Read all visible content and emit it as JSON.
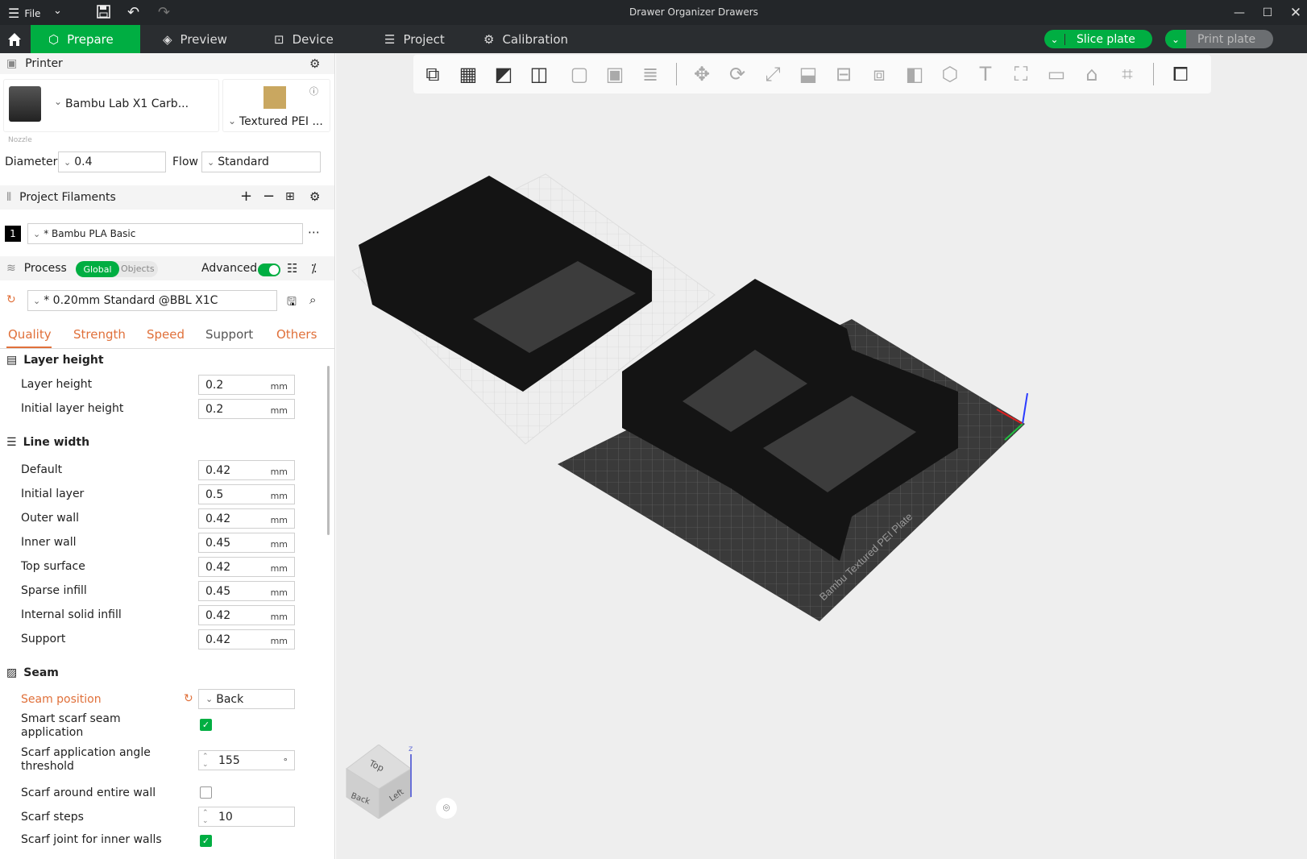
{
  "titlebar": {
    "menu_label": "File",
    "window_title": "Drawer Organizer Drawers"
  },
  "tabs": {
    "prepare": "Prepare",
    "preview": "Preview",
    "device": "Device",
    "project": "Project",
    "calibration": "Calibration"
  },
  "actions": {
    "slice_plate": "Slice plate",
    "print_plate": "Print plate"
  },
  "printer": {
    "header": "Printer",
    "name": "Bambu Lab X1 Carb...",
    "plate": "Textured PEI ...",
    "nozzle_label": "Nozzle",
    "diameter_label": "Diameter",
    "diameter_value": "0.4",
    "flow_label": "Flow",
    "flow_value": "Standard"
  },
  "filaments": {
    "header": "Project Filaments",
    "items": [
      {
        "index": "1",
        "name": "* Bambu PLA Basic"
      }
    ]
  },
  "process": {
    "header": "Process",
    "toggle_global": "Global",
    "toggle_objects": "Objects",
    "advanced_label": "Advanced",
    "preset": "* 0.20mm Standard @BBL X1C",
    "tabs": [
      "Quality",
      "Strength",
      "Speed",
      "Support",
      "Others"
    ]
  },
  "groups": {
    "layer_height": {
      "title": "Layer height",
      "rows": [
        {
          "label": "Layer height",
          "value": "0.2",
          "unit": "mm"
        },
        {
          "label": "Initial layer height",
          "value": "0.2",
          "unit": "mm"
        }
      ]
    },
    "line_width": {
      "title": "Line width",
      "rows": [
        {
          "label": "Default",
          "value": "0.42",
          "unit": "mm"
        },
        {
          "label": "Initial layer",
          "value": "0.5",
          "unit": "mm"
        },
        {
          "label": "Outer wall",
          "value": "0.42",
          "unit": "mm"
        },
        {
          "label": "Inner wall",
          "value": "0.45",
          "unit": "mm"
        },
        {
          "label": "Top surface",
          "value": "0.42",
          "unit": "mm"
        },
        {
          "label": "Sparse infill",
          "value": "0.45",
          "unit": "mm"
        },
        {
          "label": "Internal solid infill",
          "value": "0.42",
          "unit": "mm"
        },
        {
          "label": "Support",
          "value": "0.42",
          "unit": "mm"
        }
      ]
    },
    "seam": {
      "title": "Seam",
      "seam_position_label": "Seam position",
      "seam_position_value": "Back",
      "smart_scarf_label": "Smart scarf seam application",
      "smart_scarf_checked": true,
      "scarf_angle_label": "Scarf application angle threshold",
      "scarf_angle_value": "155",
      "scarf_angle_unit": "°",
      "scarf_entire_label": "Scarf around entire wall",
      "scarf_entire_checked": false,
      "scarf_steps_label": "Scarf steps",
      "scarf_steps_value": "10",
      "scarf_inner_label": "Scarf joint for inner walls",
      "scarf_inner_checked": true
    }
  },
  "viewport": {
    "bed_label": "Bambu Textured PEI Plate",
    "cube_top": "Top",
    "cube_back": "Back",
    "cube_left": "Left",
    "axis_z": "z"
  },
  "colors": {
    "accent": "#00ae42",
    "tab_active": "#e0703a",
    "titlebar": "#232629",
    "tabbar": "#2a2d30"
  }
}
